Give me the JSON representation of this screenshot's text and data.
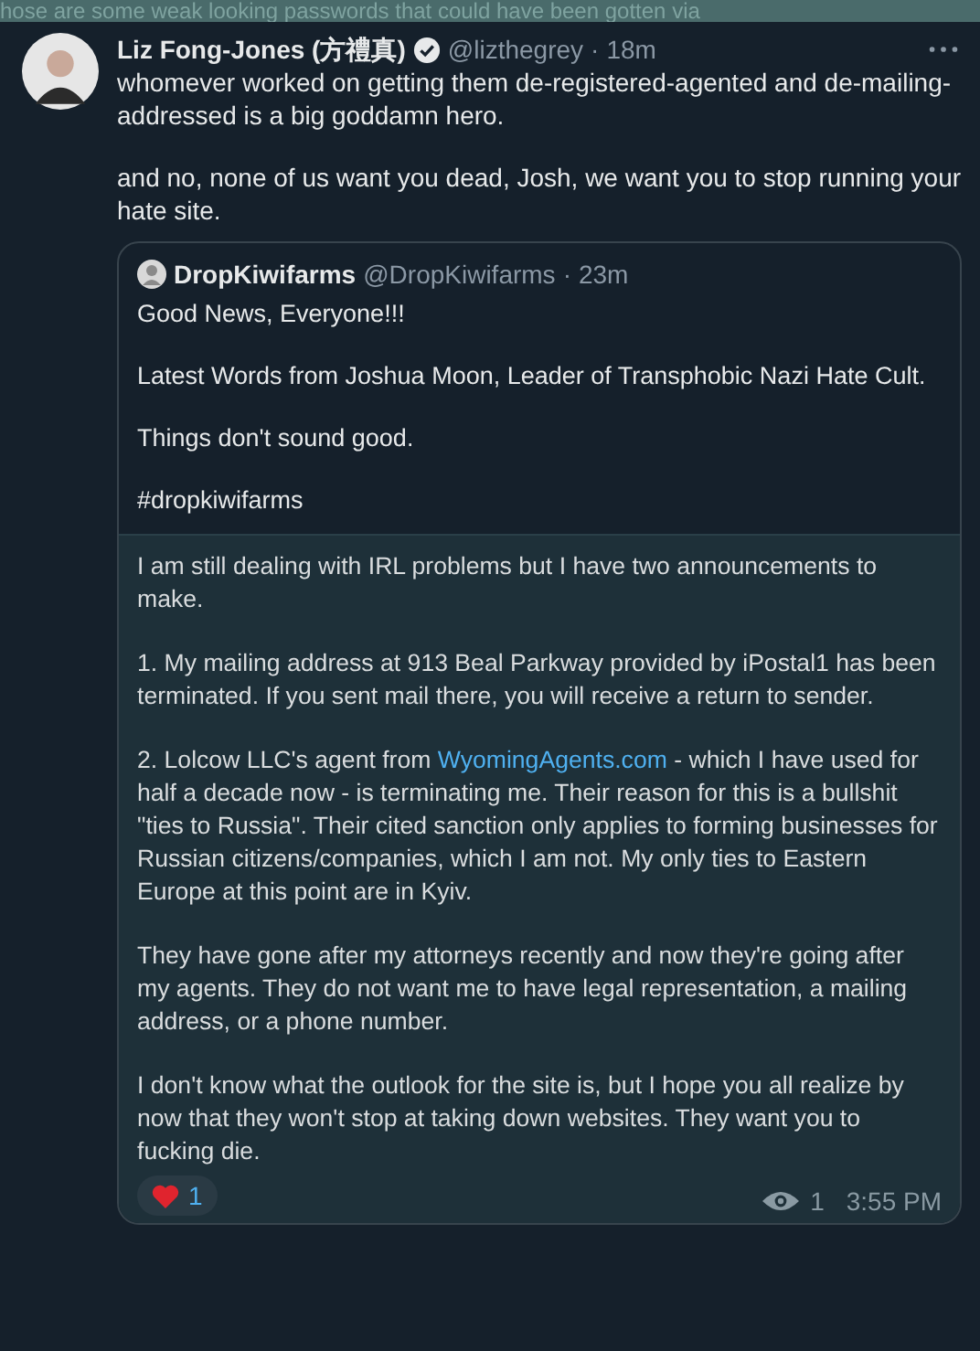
{
  "background_post": {
    "text": "hose are some weak looking passwords that could have been gotten via"
  },
  "tweet": {
    "author": {
      "name": "Liz Fong-Jones (方禮真)",
      "verified": true,
      "handle": "@lizthegrey",
      "separator": "·",
      "time": "18m"
    },
    "paragraphs": [
      "whomever worked on getting them de-registered-agented and de-mailing-addressed is a big goddamn hero.",
      "and no, none of us want you dead, Josh, we want you to stop running your hate site."
    ],
    "quote": {
      "author": {
        "name": "DropKiwifarms",
        "handle": "@DropKiwifarms",
        "separator": "·",
        "time": "23m"
      },
      "paragraphs": [
        "Good News, Everyone!!!",
        "Latest Words from Joshua Moon, Leader of Transphobic Nazi Hate Cult.",
        "Things don't sound good.",
        "#dropkiwifarms"
      ],
      "message": {
        "paragraphs": [
          [
            {
              "kind": "text",
              "text": "I am still dealing with IRL problems but I have two announcements to make."
            }
          ],
          [
            {
              "kind": "text",
              "text": "1. My mailing address at 913 Beal Parkway provided by iPostal1 has been terminated. If you sent mail there, you will receive a return to sender."
            }
          ],
          [
            {
              "kind": "text",
              "text": "2. Lolcow LLC's agent from "
            },
            {
              "kind": "link",
              "text": "WyomingAgents.com"
            },
            {
              "kind": "text",
              "text": " - which I have used for half a decade now - is terminating me. Their reason for this is a bullshit \"ties to Russia\". Their cited sanction only applies to forming businesses for Russian citizens/companies, which I am not. My only ties to Eastern Europe at this point are in Kyiv."
            }
          ],
          [
            {
              "kind": "text",
              "text": "They have gone after my attorneys recently and now they're going after my agents. They do not want me to have legal representation, a mailing address, or a phone number."
            }
          ],
          [
            {
              "kind": "text",
              "text": "I don't know what the outlook for the site is, but I hope you all realize by now that they won't stop at taking down websites. They want you to fucking die."
            }
          ]
        ],
        "reactions": [
          {
            "kind": "heart",
            "count": "1"
          }
        ],
        "views": "1",
        "time": "3:55 PM"
      }
    }
  }
}
